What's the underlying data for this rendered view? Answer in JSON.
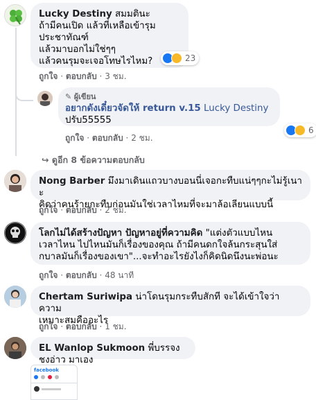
{
  "comments": [
    {
      "name": "Lucky Destiny",
      "text_line1": "สมมตินะ",
      "text_rest": "ถ้ามีคนเปิด แล้วที่เหลือเข้ารุม\nประชาทัณฑ์\nแล้วมาบอกไม่ใช่ๆๆ\nแล้วคนรุมจะเจอโทษไรไหม?",
      "reaction_count": "23",
      "like_label": "ถูกใจ",
      "reply_label": "ตอบกลับ",
      "time": "3 ชม."
    },
    {
      "author_badge": "ผู้เขียน",
      "text_line1_bold": "อยากดังเดี๋ยวจัดให้ return v.15",
      "text_line1_tag": "Lucky Destiny",
      "text_line2": "ปรับ55555",
      "reaction_count": "6",
      "like_label": "ถูกใจ",
      "reply_label": "ตอบกลับ",
      "time": "2 ชม."
    },
    {
      "more_replies": "ดูอีก 8 ข้อความตอบกลับ"
    },
    {
      "name": "Nong Barber",
      "text_line1": "มึงมาเดินแถวบางบอนนี่เจอกะทืบแน่ๆๆกะไม่รู้เนาะ",
      "text_rest": "คิดว่าคนร้ายกะทืบก่อนมันใช่เวลาไหมที่จะมาล้อเลียนแบบนี้",
      "like_label": "ถูกใจ",
      "reply_label": "ตอบกลับ",
      "time": "2 ชม."
    },
    {
      "name": "โลกไม่ได้สร้างปัญหา ปัญหาอยู่ที่ความคิด",
      "text_line1": "\"แต่งตัวแบบไหน",
      "text_rest": "เวลาไหน ไปไหนมันก็เรื่องของคุณ ถ้ามีคนดกใจล้นกระสุนใส่\nกบาลมันก็เรื่องของเขา\"...จะทำอะไรยังไงก็คิดนิดนึงนะพ่อนะ",
      "like_label": "ถูกใจ",
      "reply_label": "ตอบกลับ",
      "time": "48 นาที"
    },
    {
      "name": "Chertam Suriwipa",
      "text_line1": "น่าโดนรุมกระทืบสักที จะได้เข้าใจว่าความ",
      "text_rest": "เหมาะสมคืออะไร",
      "like_label": "ถูกใจ",
      "reply_label": "ตอบกลับ",
      "time": "1 ชม."
    },
    {
      "name": "EL Wanlop Sukmoon",
      "text_line1": "พี่บรรจงชงอ่าว มาเอง"
    }
  ],
  "attachment": {
    "brand": "facebook"
  },
  "colors": {
    "bubble": "#f0f2f5",
    "meta": "#65676b",
    "like_blue": "#1877f2",
    "haha_yellow": "#f7b928"
  }
}
